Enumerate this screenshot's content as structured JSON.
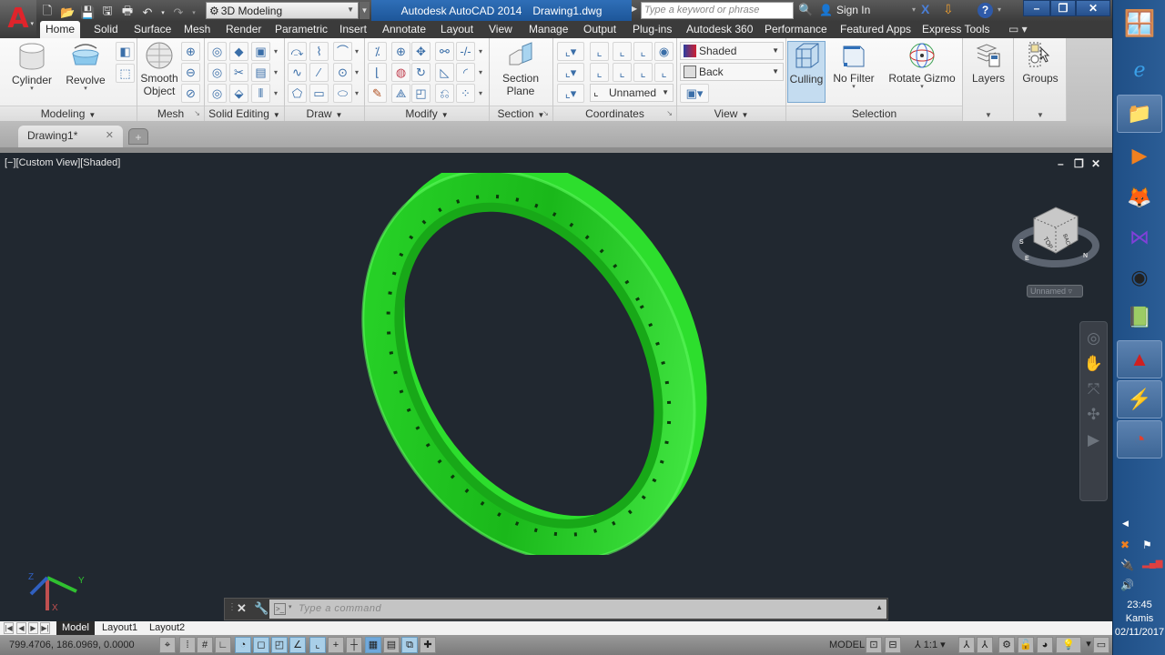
{
  "app": {
    "title": "Autodesk AutoCAD 2014",
    "document": "Drawing1.dwg",
    "workspace": "3D Modeling",
    "search_placeholder": "Type a keyword or phrase",
    "sign_in": "Sign In"
  },
  "quick_access": [
    "new-icon",
    "open-icon",
    "save-icon",
    "save-as-icon",
    "plot-icon",
    "undo-icon",
    "redo-icon"
  ],
  "ribbon_tabs": [
    "Home",
    "Solid",
    "Surface",
    "Mesh",
    "Render",
    "Parametric",
    "Insert",
    "Annotate",
    "Layout",
    "View",
    "Manage",
    "Output",
    "Plug-ins",
    "Autodesk 360",
    "Performance",
    "Featured Apps",
    "Express Tools"
  ],
  "active_tab": "Home",
  "panels": {
    "modeling": {
      "title": "Modeling",
      "cylinder": "Cylinder",
      "revolve": "Revolve"
    },
    "mesh": {
      "title": "Mesh",
      "smooth_object": [
        "Smooth",
        "Object"
      ]
    },
    "solid_editing": {
      "title": "Solid Editing"
    },
    "draw": {
      "title": "Draw"
    },
    "modify": {
      "title": "Modify"
    },
    "section": {
      "title": "Section",
      "section_plane": [
        "Section",
        "Plane"
      ]
    },
    "coordinates": {
      "title": "Coordinates",
      "ucs_combo": "Unnamed"
    },
    "view": {
      "title": "View",
      "visual_style": "Shaded",
      "view_combo": "Back"
    },
    "selection": {
      "title": "Selection",
      "culling": "Culling",
      "no_filter": "No Filter",
      "rotate_gizmo": "Rotate Gizmo"
    },
    "layers": {
      "title": "Layers"
    },
    "groups": {
      "title": "Groups"
    }
  },
  "doc_tab": {
    "label": "Drawing1*"
  },
  "viewport": {
    "label": "[−][Custom View][Shaded]",
    "viewcube_face": "TOP",
    "viewcube_side": "BACK",
    "viewcube_compass": [
      "S",
      "E",
      "N"
    ],
    "ucs_combo": "Unnamed",
    "ucs_axes": [
      "X",
      "Y",
      "Z"
    ],
    "model_color": "#22cc22"
  },
  "command": {
    "placeholder": "Type a command"
  },
  "layout_tabs": [
    "Model",
    "Layout1",
    "Layout2"
  ],
  "active_layout": "Model",
  "status": {
    "coords": "799.4706, 186.0969, 0.0000",
    "model": "MODEL",
    "annotation_scale": "1:1"
  },
  "taskbar": {
    "time": "23:45",
    "day": "Kamis",
    "date": "02/11/2017"
  }
}
